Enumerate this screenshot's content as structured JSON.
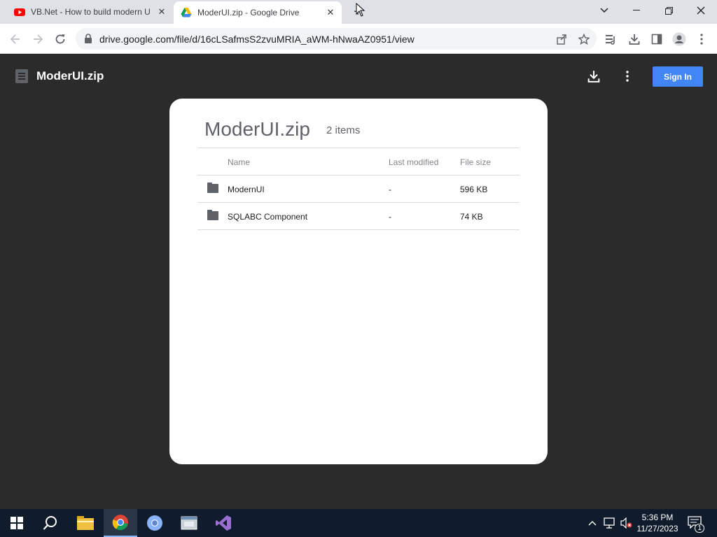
{
  "browser": {
    "tabs": [
      {
        "title": "VB.Net - How to build modern U",
        "close": "✕"
      },
      {
        "title": "ModerUI.zip - Google Drive",
        "close": "✕"
      }
    ],
    "new_tab": "+",
    "url": "drive.google.com/file/d/16cLSafmsS2zvuMRIA_aWM-hNwaAZ0951/view"
  },
  "viewer": {
    "title": "ModerUI.zip",
    "sign_in": "Sign In"
  },
  "archive": {
    "name": "ModerUI.zip",
    "item_count": "2 items",
    "columns": {
      "name": "Name",
      "modified": "Last modified",
      "size": "File size"
    },
    "items": [
      {
        "name": "ModernUI",
        "modified": "-",
        "size": "596 KB"
      },
      {
        "name": "SQLABC Component",
        "modified": "-",
        "size": "74 KB"
      }
    ]
  },
  "taskbar": {
    "time": "5:36 PM",
    "date": "11/27/2023",
    "notification_count": "1"
  },
  "colors": {
    "accent": "#4285f4",
    "viewer_bg": "#2b2b2b",
    "taskbar_bg": "#101c2c"
  }
}
